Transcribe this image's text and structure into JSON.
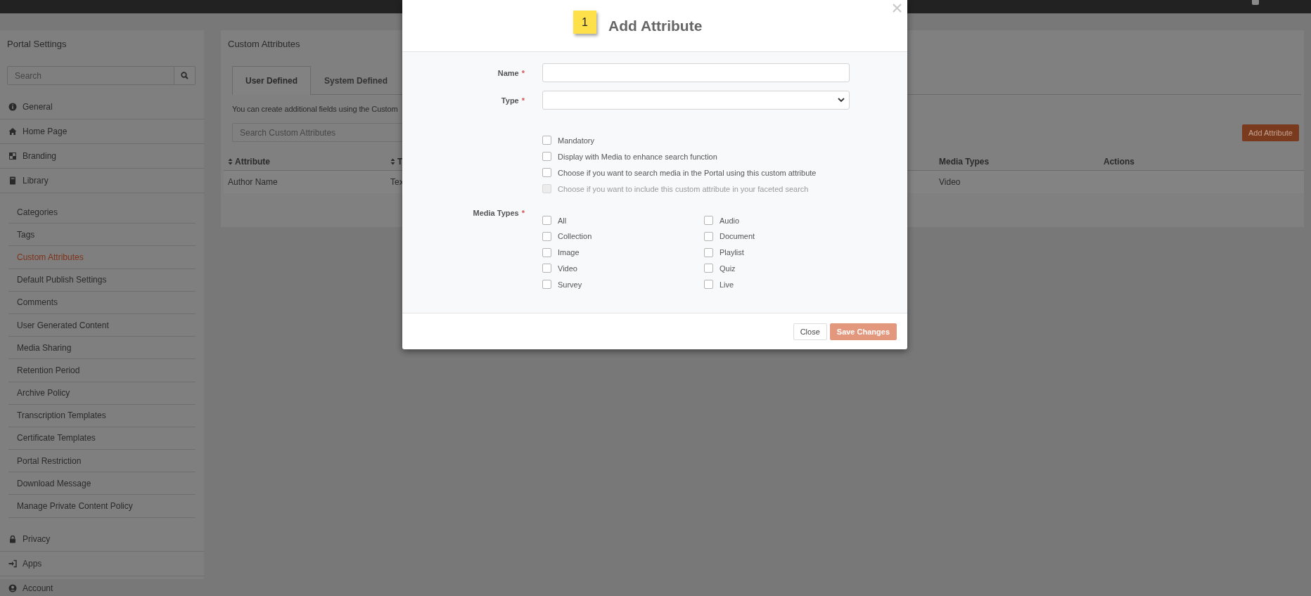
{
  "sidebar": {
    "title": "Portal Settings",
    "search": {
      "placeholder": "Search"
    },
    "items": [
      {
        "label": "General",
        "selected": false
      },
      {
        "label": "Home Page",
        "selected": false
      },
      {
        "label": "Branding",
        "selected": false
      },
      {
        "label": "Library",
        "selected": false,
        "children": [
          {
            "label": "Categories",
            "selected": false
          },
          {
            "label": "Tags",
            "selected": false
          },
          {
            "label": "Custom Attributes",
            "selected": true
          },
          {
            "label": "Default Publish Settings",
            "selected": false
          },
          {
            "label": "Comments",
            "selected": false
          },
          {
            "label": "User Generated Content",
            "selected": false
          },
          {
            "label": "Media Sharing",
            "selected": false
          },
          {
            "label": "Retention Period",
            "selected": false
          },
          {
            "label": "Archive Policy",
            "selected": false
          },
          {
            "label": "Transcription Templates",
            "selected": false
          },
          {
            "label": "Certificate Templates",
            "selected": false
          },
          {
            "label": "Portal Restriction",
            "selected": false
          },
          {
            "label": "Download Message",
            "selected": false
          },
          {
            "label": "Manage Private Content Policy",
            "selected": false
          }
        ]
      },
      {
        "label": "Privacy",
        "selected": false
      },
      {
        "label": "Apps",
        "selected": false
      },
      {
        "label": "Account",
        "selected": false
      }
    ]
  },
  "main": {
    "title": "Custom Attributes",
    "tabs": [
      {
        "label": "User Defined",
        "selected": true
      },
      {
        "label": "System Defined",
        "selected": false
      }
    ],
    "description": "You can create additional fields using the Custom",
    "search": {
      "placeholder": "Search Custom Attributes"
    },
    "add_button": "Add Attribute",
    "table": {
      "columns": [
        {
          "label": "Attribute",
          "sortable": true
        },
        {
          "label": "T",
          "sortable": true
        },
        {
          "label": "Media Types",
          "sortable": false
        },
        {
          "label": "Actions",
          "sortable": false
        }
      ],
      "rows": [
        [
          "Author Name",
          "Tex",
          "Video"
        ]
      ]
    }
  },
  "modal": {
    "step_badge": "1",
    "title": "Add Attribute",
    "fields": [
      {
        "kind": "text",
        "label": "Name",
        "required_mark": "*"
      },
      {
        "kind": "select",
        "label": "Type",
        "required_mark": "*"
      }
    ],
    "options": [
      {
        "label": "Mandatory",
        "checked": false,
        "disabled": false
      },
      {
        "label": "Display with Media to enhance search function",
        "checked": false,
        "disabled": false
      },
      {
        "label": "Choose if you want to search media in the Portal using this custom attribute",
        "checked": false,
        "disabled": false
      },
      {
        "label": "Choose if you want to include this custom attribute in your faceted search",
        "checked": false,
        "disabled": true
      }
    ],
    "media_types": {
      "label": "Media Types",
      "required_mark": "*",
      "items": [
        {
          "label": "All",
          "checked": false
        },
        {
          "label": "Audio",
          "checked": false
        },
        {
          "label": "Collection",
          "checked": false
        },
        {
          "label": "Document",
          "checked": false
        },
        {
          "label": "Image",
          "checked": false
        },
        {
          "label": "Playlist",
          "checked": false
        },
        {
          "label": "Video",
          "checked": false
        },
        {
          "label": "Quiz",
          "checked": false
        },
        {
          "label": "Survey",
          "checked": false
        },
        {
          "label": "Live",
          "checked": false
        }
      ]
    },
    "buttons": [
      {
        "kind": "close",
        "label": "Close",
        "disabled": false
      },
      {
        "kind": "save",
        "label": "Save Changes",
        "disabled": true
      }
    ]
  }
}
